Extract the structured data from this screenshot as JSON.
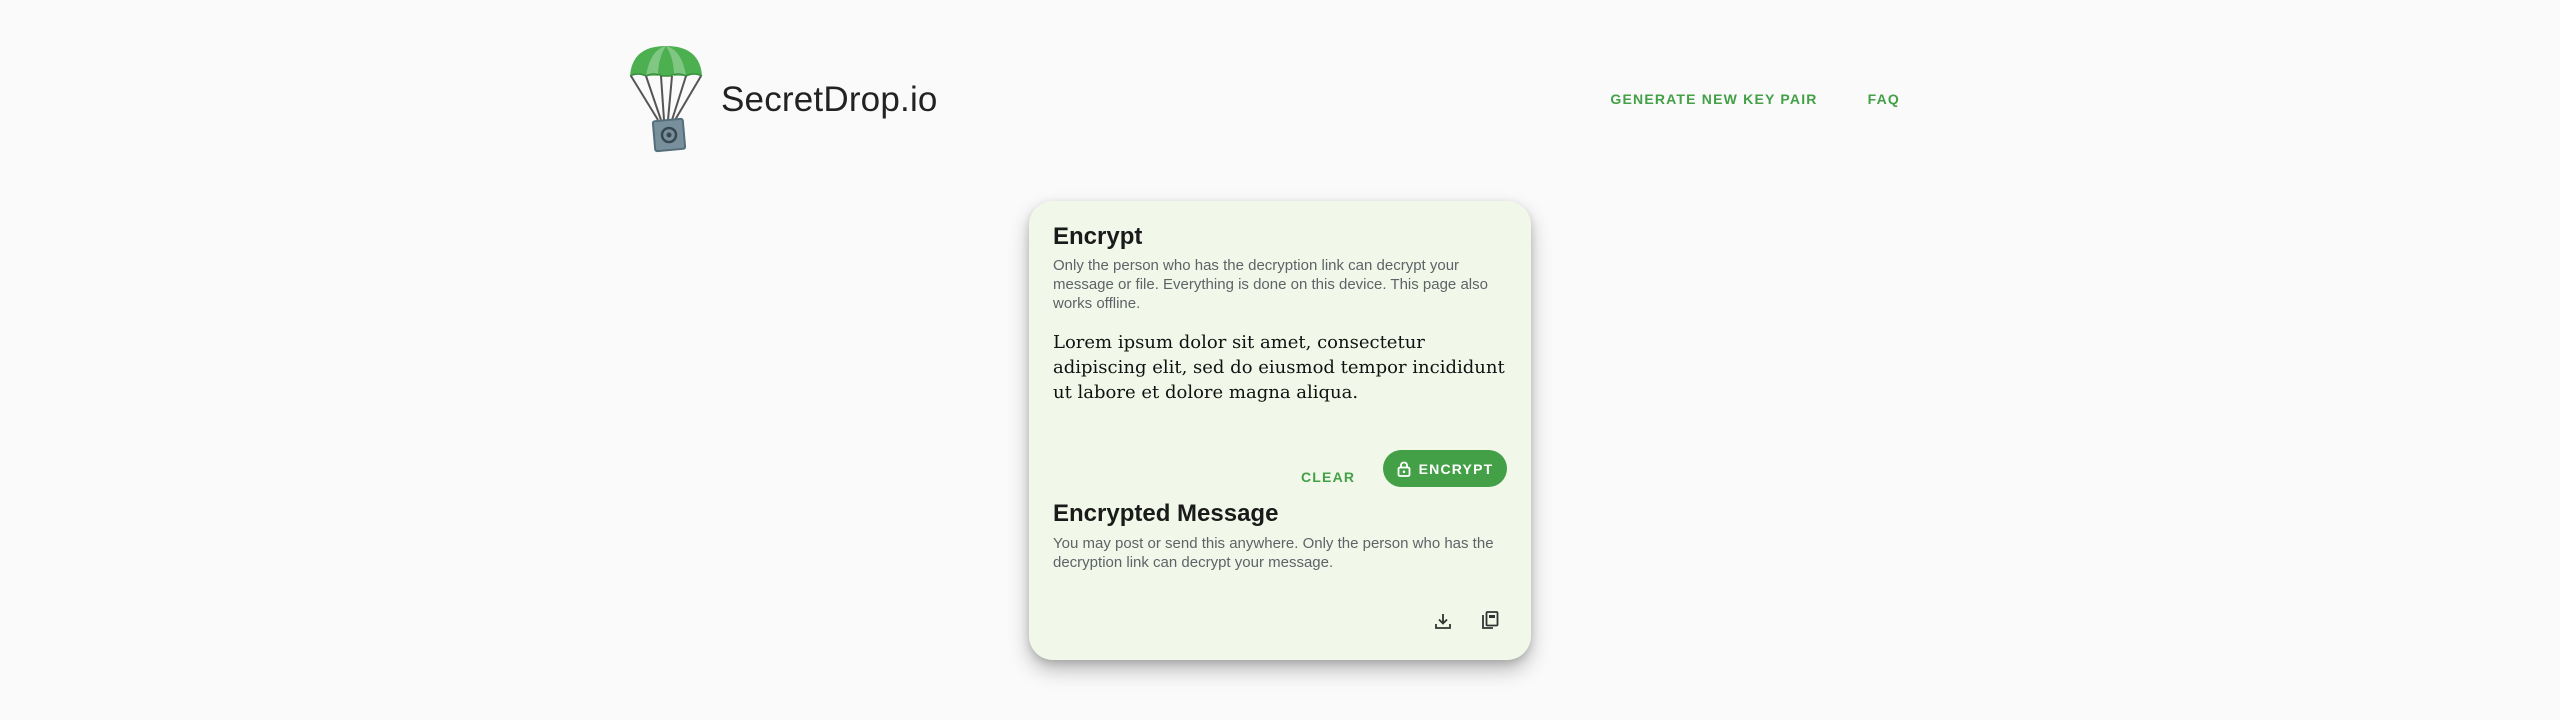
{
  "header": {
    "brand": "SecretDrop.io",
    "logo_icon": "parachute-safe-icon",
    "nav": [
      {
        "label": "GENERATE NEW KEY PAIR"
      },
      {
        "label": "FAQ"
      }
    ]
  },
  "encrypt": {
    "title": "Encrypt",
    "description": "Only the person who has the decryption link can decrypt your message or file. Everything is done on this device. This page also works offline.",
    "message": "Lorem ipsum dolor sit amet, consectetur adipiscing elit, sed do eiusmod tempor incididunt ut labore et dolore magna aliqua.",
    "clear_label": "CLEAR",
    "encrypt_label": "ENCRYPT",
    "encrypt_icon": "lock-icon"
  },
  "encrypted_message": {
    "title": "Encrypted Message",
    "description": "You may post or send this anywhere. Only the person who has the decryption link can decrypt your message.",
    "download_icon": "download-icon",
    "copy_icon": "copy-icon"
  },
  "colors": {
    "accent": "#43a047",
    "card_bg": "#f1f8e9",
    "page_bg": "#fafafa"
  }
}
